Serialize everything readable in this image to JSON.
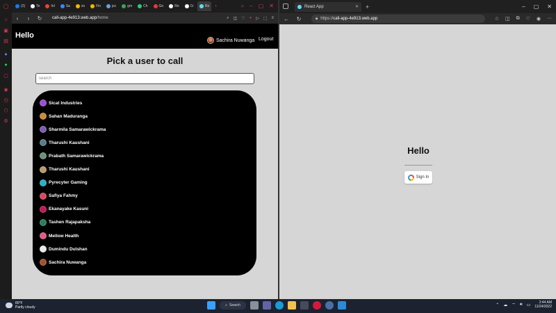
{
  "opera": {
    "sidebar_icons": [
      "opera-logo-icon",
      "home-icon",
      "shopping-bag-icon",
      "twitch-icon",
      "messenger-icon",
      "whatsapp-icon",
      "instagram-icon",
      "music-player-icon",
      "history-icon",
      "box-icon",
      "settings-icon"
    ],
    "tabs": [
      {
        "label": "(2)",
        "color": "#1877f2"
      },
      {
        "label": "Te",
        "color": "#ffffff"
      },
      {
        "label": "Inl",
        "color": "#ea4335"
      },
      {
        "label": "Sa",
        "color": "#4285f4"
      },
      {
        "label": "zo",
        "color": "#f4b400"
      },
      {
        "label": "Fin",
        "color": "#f4b400"
      },
      {
        "label": "jsc",
        "color": "#6aa0e0"
      },
      {
        "label": "gm",
        "color": "#34a853"
      },
      {
        "label": "Ch",
        "color": "#2ecc71"
      },
      {
        "label": "Go",
        "color": "#e53935"
      },
      {
        "label": "Re",
        "color": "#ffffff"
      },
      {
        "label": "Cr",
        "color": "#ffffff"
      },
      {
        "label": "Re",
        "color": "#61dafb"
      }
    ],
    "url_host": "call-app-4e913.web.app",
    "url_path": "/home"
  },
  "app": {
    "header_title": "Hello",
    "current_user": "Sachira Nuwanga",
    "logout_label": "Logout",
    "page_title": "Pick a user to call",
    "search_placeholder": "search",
    "users": [
      {
        "name": "Sicat Industries",
        "color": "#9c4fd6"
      },
      {
        "name": "Sahan Maduranga",
        "color": "#c78b3a"
      },
      {
        "name": "Sharmila Samarawickrama",
        "color": "#7a5fb0"
      },
      {
        "name": "Tharushi Kaushani",
        "color": "#5a7d8a"
      },
      {
        "name": "Prabath Samarawickrama",
        "color": "#6b8f7a"
      },
      {
        "name": "Tharushi Kaushani",
        "color": "#b99a6a"
      },
      {
        "name": "Pyrecyter Gaming",
        "color": "#2bb0c8"
      },
      {
        "name": "Safiya Fahmy",
        "color": "#d9485f"
      },
      {
        "name": "Ekanayake Kasuni",
        "color": "#c2185b"
      },
      {
        "name": "Tashen Rajapaksha",
        "color": "#2e7d5b"
      },
      {
        "name": "Mellow Health",
        "color": "#e05a8a"
      },
      {
        "name": "Dumindu Dulshan",
        "color": "#e8e8e8"
      },
      {
        "name": "Sachira Nuwanga",
        "color": "#a0522d"
      }
    ]
  },
  "edge": {
    "tab_title": "React App",
    "url_prefix": "https://",
    "url_host": "call-app-4e913.web.app",
    "page_title": "Hello",
    "signin_label": "Sign In"
  },
  "taskbar": {
    "temperature": "80°F",
    "weather": "Partly cloudy",
    "search_label": "Search",
    "time": "2:44 AM",
    "date": "11/24/2022"
  }
}
